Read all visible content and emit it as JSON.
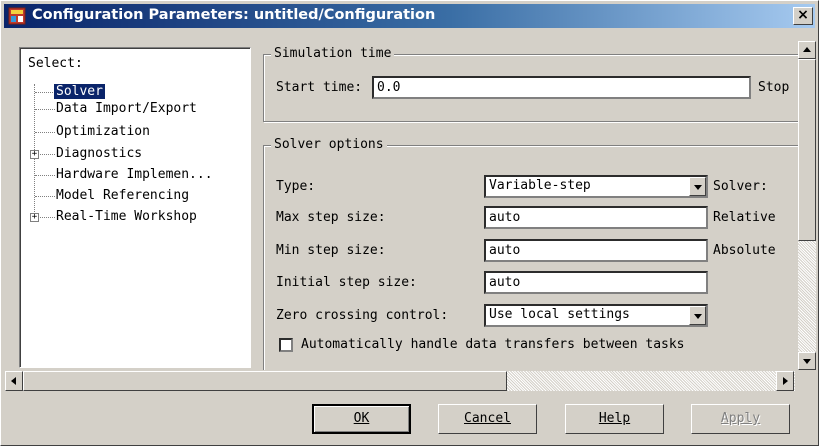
{
  "window": {
    "title": "Configuration Parameters: untitled/Configuration",
    "close_glyph": "×",
    "icon": "simulink-config-icon"
  },
  "tree": {
    "header": "Select:",
    "items": [
      {
        "label": "Solver",
        "selected": true,
        "expandable": false
      },
      {
        "label": "Data Import/Export",
        "selected": false,
        "expandable": false
      },
      {
        "label": "Optimization",
        "selected": false,
        "expandable": false
      },
      {
        "label": "Diagnostics",
        "selected": false,
        "expandable": true
      },
      {
        "label": "Hardware Implemen...",
        "selected": false,
        "expandable": false
      },
      {
        "label": "Model Referencing",
        "selected": false,
        "expandable": false
      },
      {
        "label": "Real-Time Workshop",
        "selected": false,
        "expandable": true
      }
    ],
    "expander_glyph": "+"
  },
  "simulation_time": {
    "legend": "Simulation time",
    "start_label": "Start time:",
    "start_value": "0.0",
    "stop_label": "Stop"
  },
  "solver_options": {
    "legend": "Solver options",
    "type_label": "Type:",
    "type_value": "Variable-step",
    "solver_label": "Solver:",
    "max_step_label": "Max step size:",
    "max_step_value": "auto",
    "relative_label": "Relative",
    "min_step_label": "Min step size:",
    "min_step_value": "auto",
    "absolute_label": "Absolute",
    "initial_step_label": "Initial step size:",
    "initial_step_value": "auto",
    "zero_crossing_label": "Zero crossing control:",
    "zero_crossing_value": "Use local settings",
    "auto_transfer_label": "Automatically handle data transfers between tasks",
    "auto_transfer_checked": false
  },
  "buttons": {
    "ok": "OK",
    "cancel": "Cancel",
    "help": "Help",
    "apply": "Apply"
  },
  "colors": {
    "title_bar_start": "#0a246a",
    "title_bar_end": "#a6caf0",
    "selection": "#0a246a",
    "face": "#d4d0c8"
  }
}
